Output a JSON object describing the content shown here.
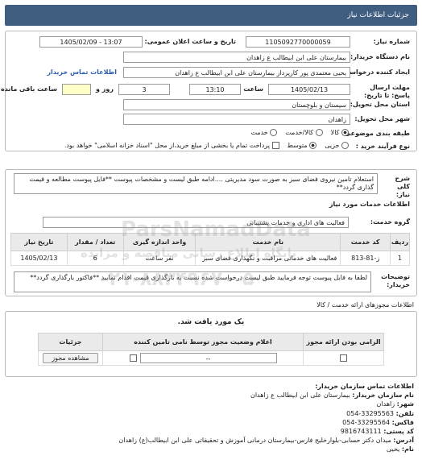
{
  "header": {
    "title": "جزئیات اطلاعات نیاز"
  },
  "form": {
    "need_number_label": "شماره نیاز:",
    "need_number": "1105092770000059",
    "announce_label": "تاریخ و ساعت اعلان عمومی:",
    "announce_value": "1405/02/09 - 13:07",
    "buyer_org_label": "نام دستگاه خریدار:",
    "buyer_org": "بیمارستان علی ابن ابیطالب  ع  زاهدان",
    "creator_label": "ایجاد کننده درخواست:",
    "creator": "یحیی معتمدی پور کارپرداز بیمارستان علی ابن ابیطالب  ع  زاهدان",
    "buyer_contact_link": "اطلاعات تماس خریدار",
    "deadline_label": "مهلت ارسال پاسخ: تا تاریخ:",
    "deadline_date": "1405/02/13",
    "time_label": "ساعت",
    "deadline_time": "13:10",
    "days_value": "3",
    "days_label": "روز و",
    "remaining_label": "ساعت باقی مانده",
    "province_label": "استان محل تحویل:",
    "province": "سیستان و بلوچستان",
    "city_label": "شهر محل تحویل:",
    "city": "زاهدان",
    "category_label": "طبقه بندی موضوعی:",
    "category_options": [
      "کالا",
      "کالا/خدمت",
      "خدمت"
    ],
    "process_label": "نوع فرآیند خرید :",
    "process_options": [
      "جزیی",
      "متوسط"
    ],
    "payment_text": "پرداخت تمام یا بخشی از مبلغ خرید،از محل \"اسناد خزانه اسلامی\" خواهد بود."
  },
  "summary": {
    "label": "شرح کلی نیاز:",
    "text": "استعلام تامین نیروی فضای سبز به صورت سود مدیریتی ....ادامه طبق لیست و مشخصات پیوست **فایل پیوست مطالعه و قیمت گذاری گردد**"
  },
  "services": {
    "section_title": "اطلاعات خدمات مورد نیاز",
    "group_label": "گروه خدمت:",
    "group_value": "فعالیت های اداری و خدمات پشتیبانی",
    "columns": [
      "ردیف",
      "کد خدمت",
      "نام خدمت",
      "واحد اندازه گیری",
      "تعداد / مقدار",
      "تاریخ نیاز"
    ],
    "rows": [
      [
        "1",
        "ز-81-813",
        "فعالیت های خدماتی مراقبت و نگهداری فضای سبز",
        "نفر ساعت",
        "6",
        "1405/02/13"
      ]
    ],
    "buyer_notes_label": "توضیحات خریدار:",
    "buyer_notes": "لطفا به فایل پیوست توجه فرمایید طبق لیست درخواست شده نسبت به بارگذاری قیمت اقدام نمایید **فاکتور بارگذاری گردد**"
  },
  "permits": {
    "section_title": "اطلاعات مجوزهای ارائه خدمت / کالا",
    "empty_text": "یک مورد یافت شد.",
    "columns": [
      "الزامی بودن ارائه مجوز",
      "اعلام وضعیت مجوز توسط نامی تامین کننده",
      "جزئیات"
    ],
    "status_value": "--",
    "view_button": "مشاهده مجوز"
  },
  "contact": {
    "section_title": "اطلاعات تماس سازمان خریدار:",
    "lines": [
      {
        "label": "نام سازمان خریدار:",
        "value": "بیمارستان علی ابن ابیطالب ع زاهدان"
      },
      {
        "label": "شهر:",
        "value": "زاهدان"
      },
      {
        "label": "تلفن:",
        "value": "054-33295563"
      },
      {
        "label": "فاکس:",
        "value": "054-33295564"
      },
      {
        "label": "کد پستی:",
        "value": "9816743111"
      },
      {
        "label": "آدرس:",
        "value": "میدان دکتر حسابی-بلوارخلیج فارس-بیمارستان درمانی آموزش و تحقیقاتی علی ابن ابیطالب(ع) زاهدان"
      },
      {
        "label": "نام:",
        "value": "یحیی"
      }
    ]
  },
  "watermark": {
    "brand": "ParsNamadData",
    "line1": "پایگاه اطلاع رسانی مناقصه و مزایده",
    "phone": "۰۲۱-۸۸۳۴۹۶۷۰-۵"
  }
}
